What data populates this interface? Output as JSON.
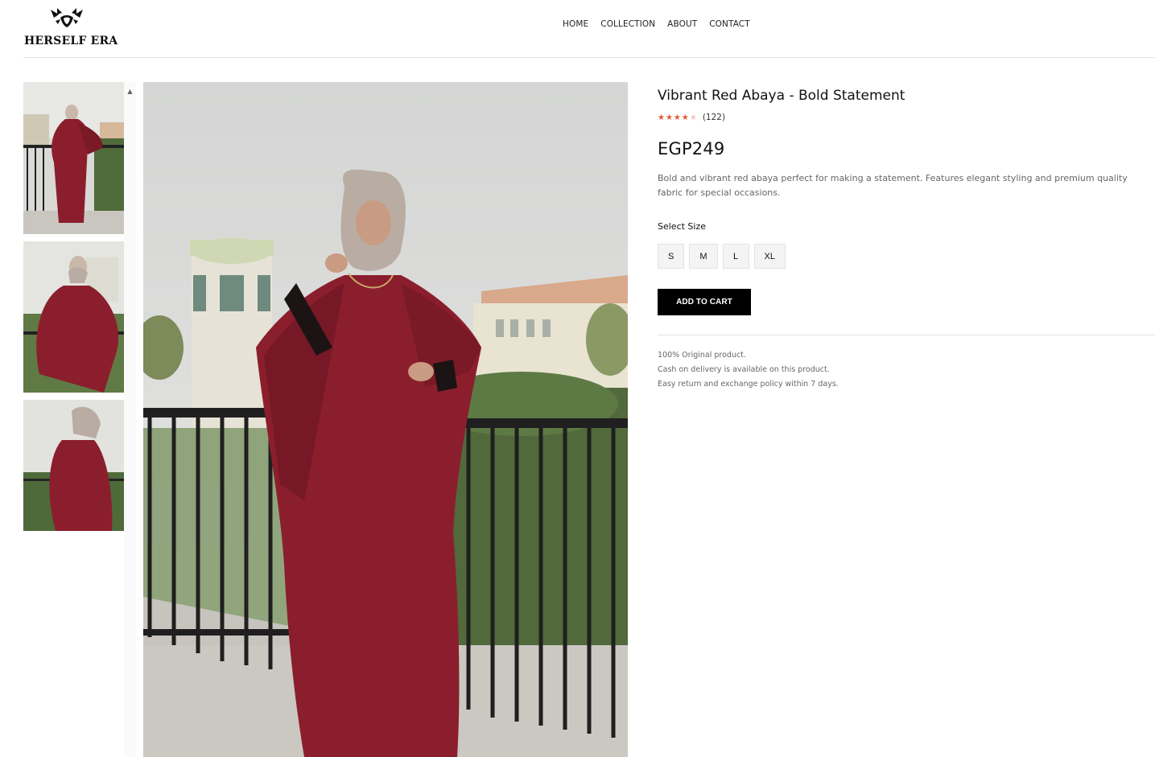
{
  "brand": {
    "name": "HERSELF ERA",
    "logo_icon": "butterfly-logo-icon"
  },
  "nav": {
    "items": [
      "HOME",
      "COLLECTION",
      "ABOUT",
      "CONTACT"
    ]
  },
  "gallery": {
    "thumbnails": [
      "Abaya photo 1",
      "Abaya photo 2",
      "Abaya photo 3"
    ],
    "scroll_icon": "caret-up-icon"
  },
  "product": {
    "title": "Vibrant Red Abaya - Bold Statement",
    "rating": 4,
    "rating_max": 5,
    "review_count": "(122)",
    "price": "EGP249",
    "description": "Bold and vibrant red abaya perfect for making a statement. Features elegant styling and premium quality fabric for special occasions.",
    "size_label": "Select Size",
    "sizes": [
      "S",
      "M",
      "L",
      "XL"
    ],
    "add_to_cart": "ADD TO CART",
    "policies": [
      "100% Original product.",
      "Cash on delivery is available on this product.",
      "Easy return and exchange policy within 7 days."
    ]
  },
  "colors": {
    "abaya": "#8b1e2c",
    "star": "#e4572e",
    "button": "#000000"
  }
}
